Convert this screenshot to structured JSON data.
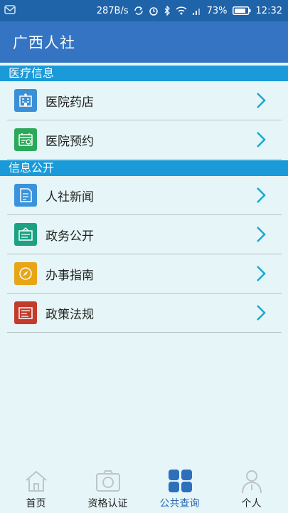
{
  "status_bar": {
    "network_speed": "287B/s",
    "battery": "73%",
    "time": "12:32"
  },
  "app_bar": {
    "title": "广西人社"
  },
  "sections": [
    {
      "title": "医疗信息",
      "items": [
        {
          "label": "医院药店",
          "icon": "hospital-icon",
          "color": "#3a8fd7"
        },
        {
          "label": "医院预约",
          "icon": "calendar-icon",
          "color": "#2ba95a"
        }
      ]
    },
    {
      "title": "信息公开",
      "items": [
        {
          "label": "人社新闻",
          "icon": "news-icon",
          "color": "#3a93dc"
        },
        {
          "label": "政务公开",
          "icon": "bulletin-icon",
          "color": "#1aa283"
        },
        {
          "label": "办事指南",
          "icon": "compass-icon",
          "color": "#e8a515"
        },
        {
          "label": "政策法规",
          "icon": "document-icon",
          "color": "#c23b2c"
        }
      ]
    }
  ],
  "tabs": [
    {
      "label": "首页",
      "icon": "home-icon"
    },
    {
      "label": "资格认证",
      "icon": "camera-icon"
    },
    {
      "label": "公共查询",
      "icon": "grid-icon",
      "active": true
    },
    {
      "label": "个人",
      "icon": "person-icon"
    }
  ],
  "colors": {
    "status_bar": "#1f63a8",
    "app_bar": "#3474c2",
    "section_header": "#1a9ad9",
    "chevron": "#1aa8cf",
    "active_tab": "#2a6ab8",
    "background": "#e6f5f7"
  }
}
